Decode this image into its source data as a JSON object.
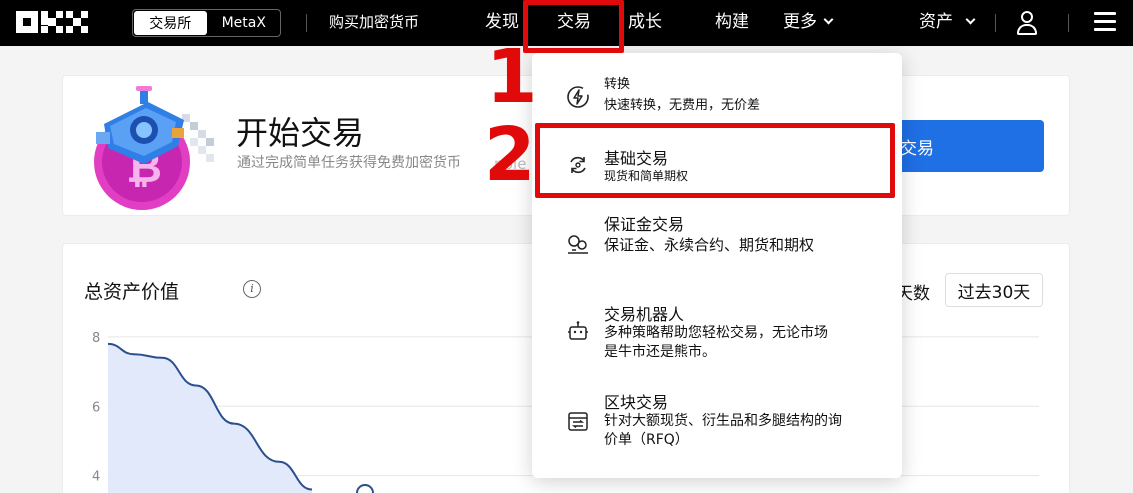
{
  "header": {
    "mode_switch": {
      "exchange": "交易所",
      "metax": "MetaX"
    },
    "buy_crypto": "购买加密货币",
    "nav": [
      "发现",
      "交易",
      "成长",
      "构建",
      "更多"
    ],
    "assets": "资产"
  },
  "annotations": {
    "step1": "1",
    "step2": "2"
  },
  "start_card": {
    "title": "开始交易",
    "subtitle": "通过完成简单任务获得免费加密货币",
    "ghost": "nple",
    "button_label": "交易"
  },
  "asset_card": {
    "title": "总资产价值",
    "info_icon_text": "i",
    "days_label": "天数",
    "range_button": "过去30天"
  },
  "chart_data": {
    "type": "area",
    "y_ticks": [
      "8",
      "6",
      "4"
    ],
    "ylim": [
      3.5,
      8.2
    ],
    "series": [
      {
        "values": [
          7.8,
          7.5,
          7.4,
          6.6,
          5.5,
          4.4,
          3.6
        ]
      }
    ],
    "grid": true
  },
  "dropdown": {
    "items": [
      {
        "title": "转换",
        "desc": "快速转换，无费用，无价差"
      },
      {
        "title": "基础交易",
        "desc": "现货和简单期权"
      },
      {
        "title": "保证金交易",
        "desc": "保证金、永续合约、期货和期权"
      },
      {
        "title": "交易机器人",
        "desc_lines": [
          "多种策略帮助您轻松交易，无论市场",
          "是牛市还是熊市。"
        ]
      },
      {
        "title": "区块交易",
        "desc_lines": [
          "针对大额现货、衍生品和多腿结构的询",
          "价单（RFQ）"
        ]
      }
    ],
    "icons": [
      "lightning-circle-icon",
      "refresh-circle-icon",
      "coins-icon",
      "robot-icon",
      "block-trade-icon"
    ]
  },
  "colors": {
    "accent": "#1f6fe5",
    "highlight": "#e10a0a",
    "topbar": "#000000"
  }
}
